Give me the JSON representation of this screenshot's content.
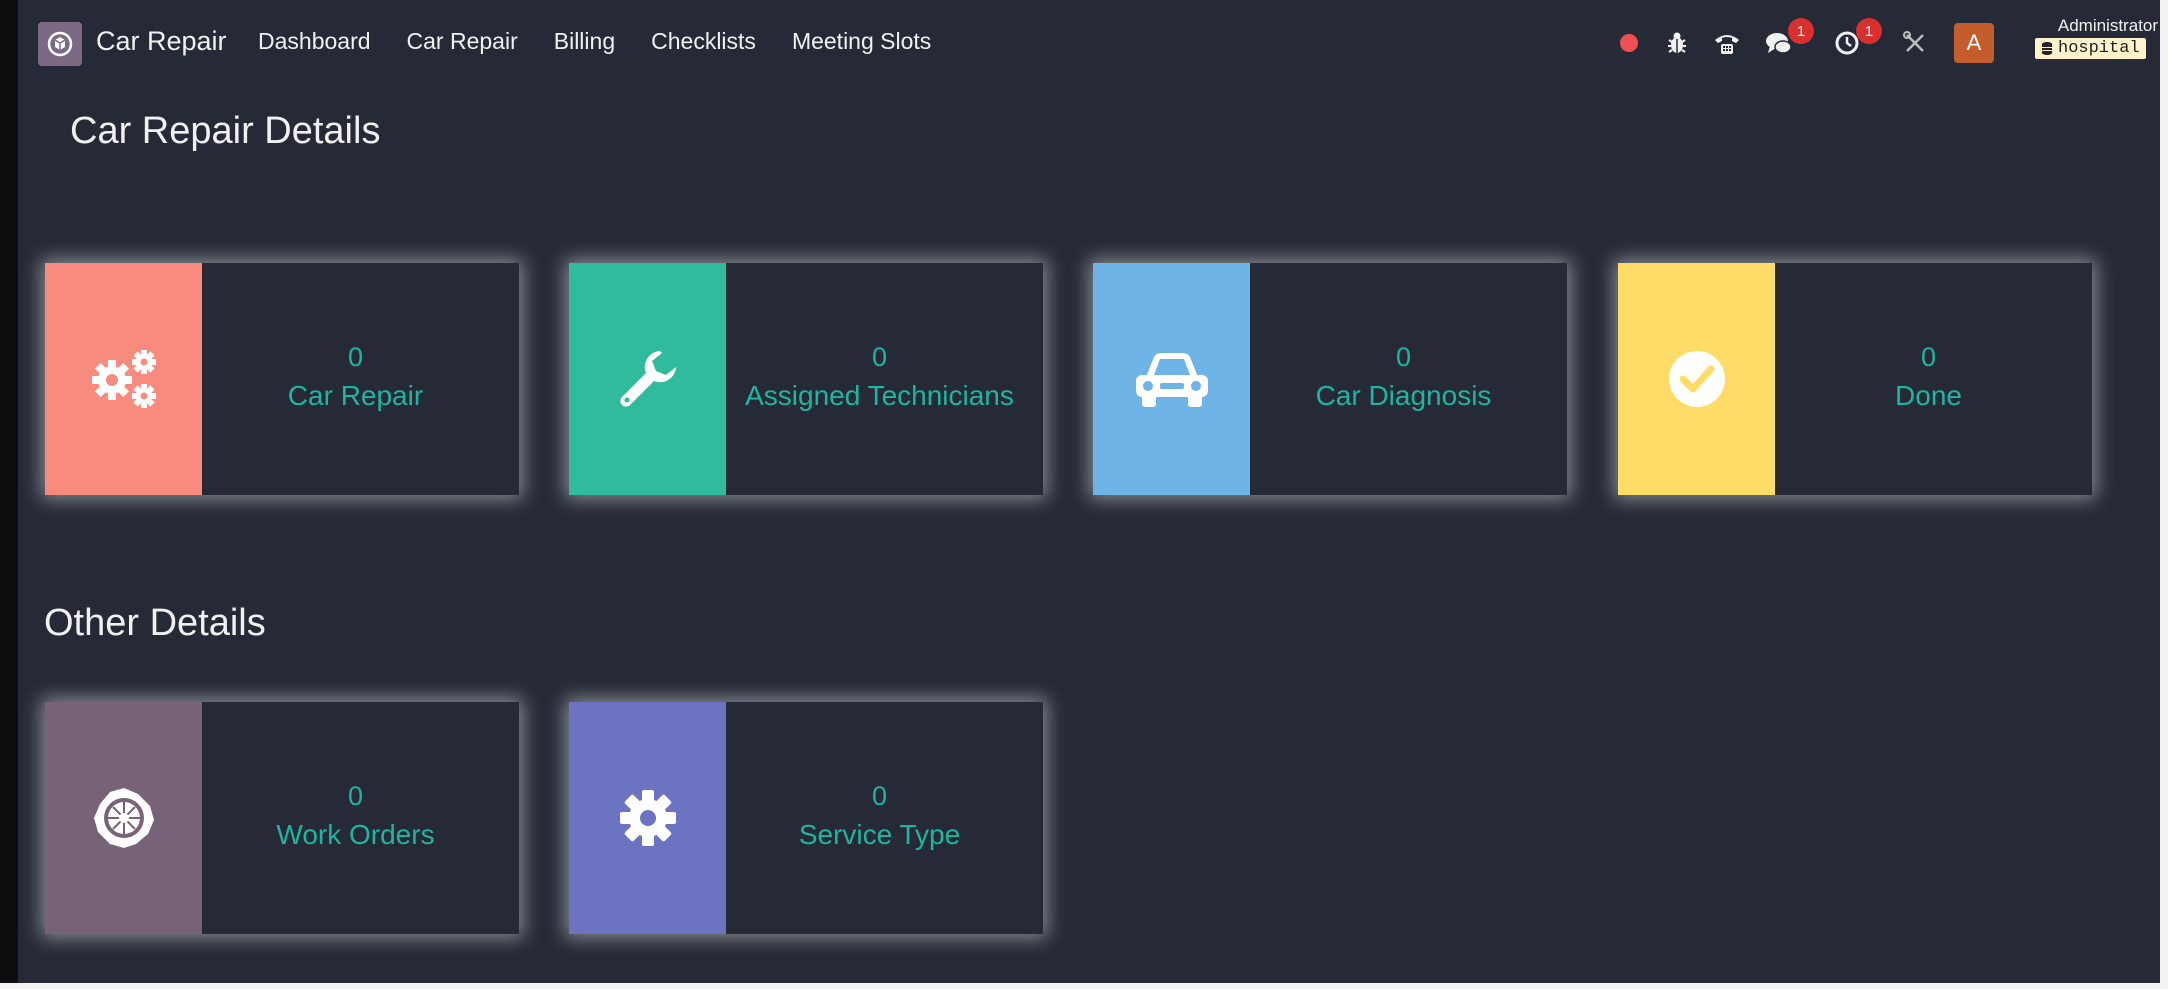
{
  "navbar": {
    "brand": "Car Repair",
    "menu": [
      "Dashboard",
      "Car Repair",
      "Billing",
      "Checklists",
      "Meeting Slots"
    ],
    "messages_badge": "1",
    "activities_badge": "1",
    "avatar_letter": "A",
    "user_name": "Administrator",
    "database": "hospital",
    "icons": [
      "recording-dot",
      "bug-icon",
      "phone-icon",
      "chat-icon",
      "clock-icon",
      "tools-icon"
    ]
  },
  "sections": {
    "car_repair_title": "Car Repair Details",
    "other_title": "Other Details"
  },
  "cards": [
    {
      "count": "0",
      "label": "Car Repair",
      "icon": "gears-icon",
      "color": "#f88a7e"
    },
    {
      "count": "0",
      "label": "Assigned Technicians",
      "icon": "wrench-icon",
      "color": "#2fbb9c"
    },
    {
      "count": "0",
      "label": "Car Diagnosis",
      "icon": "car-icon",
      "color": "#6eb4e6"
    },
    {
      "count": "0",
      "label": "Done",
      "icon": "check-circle-icon",
      "color": "#ffdb67"
    },
    {
      "count": "0",
      "label": "Work Orders",
      "icon": "badge-icon",
      "color": "#776377"
    },
    {
      "count": "0",
      "label": "Service Type",
      "icon": "gear-icon",
      "color": "#6c73c0"
    }
  ],
  "colors": {
    "background": "#262a36",
    "accent_text": "#1fb5a0",
    "badge": "#d7302f",
    "avatar": "#c45d2c"
  }
}
